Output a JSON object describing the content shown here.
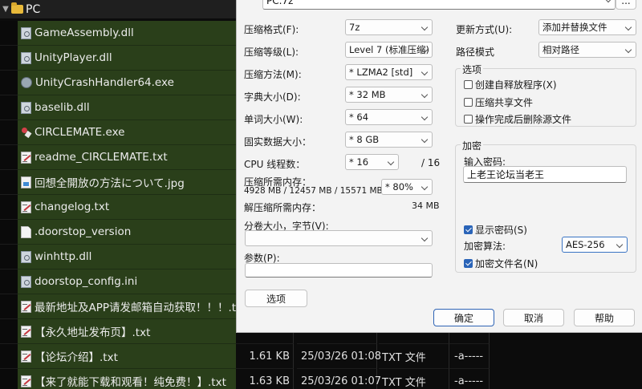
{
  "file_manager": {
    "root_folder": "PC",
    "rows": [
      {
        "name": "GameAssembly.dll",
        "icon": "gear",
        "size": "",
        "date": "",
        "type": "",
        "attr": ""
      },
      {
        "name": "UnityPlayer.dll",
        "icon": "gear",
        "size": "",
        "date": "",
        "type": "",
        "attr": ""
      },
      {
        "name": "UnityCrashHandler64.exe",
        "icon": "crash",
        "size": "",
        "date": "",
        "type": "",
        "attr": ""
      },
      {
        "name": "baselib.dll",
        "icon": "gear",
        "size": "",
        "date": "",
        "type": "",
        "attr": ""
      },
      {
        "name": "CIRCLEMATE.exe",
        "icon": "cm",
        "size": "",
        "date": "",
        "type": "",
        "attr": ""
      },
      {
        "name": "readme_CIRCLEMATE.txt",
        "icon": "txt",
        "size": "",
        "date": "",
        "type": "",
        "attr": ""
      },
      {
        "name": "回想全開放の方法について.jpg",
        "icon": "jpg",
        "size": "",
        "date": "",
        "type": "",
        "attr": ""
      },
      {
        "name": "changelog.txt",
        "icon": "txt",
        "size": "",
        "date": "",
        "type": "",
        "attr": ""
      },
      {
        "name": ".doorstop_version",
        "icon": "doc",
        "size": "",
        "date": "",
        "type": "",
        "attr": ""
      },
      {
        "name": "winhttp.dll",
        "icon": "gear",
        "size": "",
        "date": "",
        "type": "",
        "attr": ""
      },
      {
        "name": "doorstop_config.ini",
        "icon": "gear",
        "size": "",
        "date": "",
        "type": "",
        "attr": ""
      },
      {
        "name": "最新地址及APP请发邮箱自动获取！！！.txt",
        "icon": "txt",
        "size": "",
        "date": "",
        "type": "",
        "attr": ""
      },
      {
        "name": "【永久地址发布页】.txt",
        "icon": "txt",
        "size": "",
        "date": "",
        "type": "",
        "attr": ""
      },
      {
        "name": "【论坛介绍】.txt",
        "icon": "txt",
        "size": "1.61 KB",
        "date": "25/03/26  01:08",
        "type": "TXT 文件",
        "attr": "-a-----"
      },
      {
        "name": "【来了就能下载和观看！纯免费！】.txt",
        "icon": "txt",
        "size": "1.63 KB",
        "date": "25/03/26  01:07",
        "type": "TXT 文件",
        "attr": "-a-----"
      }
    ]
  },
  "dialog": {
    "archive_name": "PC.7z",
    "browse_label": "...",
    "left": {
      "format_label": "压缩格式(F):",
      "format_value": "7z",
      "level_label": "压缩等级(L):",
      "level_value": "Level 7 (标准压缩)",
      "method_label": "压缩方法(M):",
      "method_value": "*  LZMA2 [std]",
      "dict_label": "字典大小(D):",
      "dict_value": "*  32 MB",
      "word_label": "单词大小(W):",
      "word_value": "*  64",
      "solid_label": "固实数据大小：",
      "solid_value": "*  8 GB",
      "threads_label": "CPU 线程数：",
      "threads_value": "*  16",
      "threads_total": "/ 16",
      "mem_label": "压缩所需内存：",
      "mem_value": "4928 MB / 12457 MB / 15571 MB",
      "mem_percent": "* 80%",
      "decomp_label": "解压缩所需内存：",
      "decomp_value": "34 MB",
      "split_label": "分卷大小，字节(V):",
      "split_value": "",
      "params_label": "参数(P):",
      "params_value": "",
      "options_button": "选项"
    },
    "right": {
      "update_label": "更新方式(U):",
      "update_value": "添加并替换文件",
      "path_label": "路径模式",
      "path_value": "相对路径",
      "options_title": "选项",
      "opt_sfx": "创建自释放程序(X)",
      "opt_shared": "压缩共享文件",
      "opt_delete": "操作完成后删除源文件",
      "enc_title": "加密",
      "password_label": "输入密码:",
      "password_value": "上老王论坛当老王",
      "show_password": "显示密码(S)",
      "enc_method_label": "加密算法:",
      "enc_method_value": "AES-256",
      "enc_names": "加密文件名(N)"
    },
    "buttons": {
      "ok": "确定",
      "cancel": "取消",
      "help": "帮助"
    }
  },
  "colors": {
    "accent": "#2a64b8",
    "row_highlight": "#2a3f1a",
    "dialog_bg": "#f3f3f3"
  }
}
